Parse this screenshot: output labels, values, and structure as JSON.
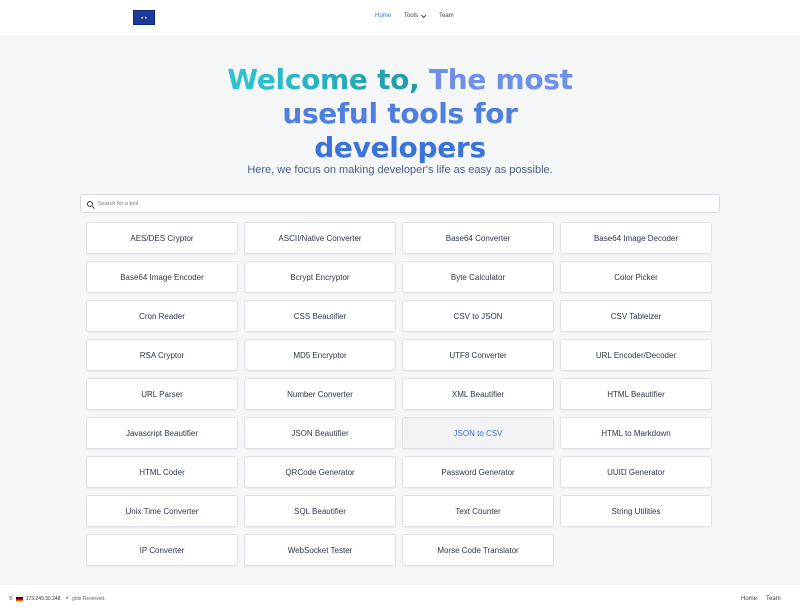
{
  "header": {
    "logo_text": "★★",
    "nav": [
      {
        "label": "Home",
        "active": true
      },
      {
        "label": "Tools"
      },
      {
        "label": "Team"
      }
    ]
  },
  "hero": {
    "title_part1": "Welcome to,",
    "title_part2": "The most",
    "title_part3": "useful tools for",
    "title_part4": "developers",
    "subtitle": "Here, we focus on making developer's life as easy as possible."
  },
  "search": {
    "placeholder": "Search for a tool",
    "value": ""
  },
  "tools": [
    "AES/DES Cryptor",
    "ASCII/Native Converter",
    "Base64 Converter",
    "Base64 Image Decoder",
    "Base64 Image Encoder",
    "Bcrypt Encryptor",
    "Byte Calculator",
    "Color Picker",
    "Cron Reader",
    "CSS Beautifier",
    "CSV to JSON",
    "CSV Tableizer",
    "RSA Cryptor",
    "MD5 Encryptor",
    "UTF8 Converter",
    "URL Encoder/Decoder",
    "URL Parser",
    "Number Converter",
    "XML Beautifier",
    "HTML Beautifier",
    "Javascript Beautifier",
    "JSON Beautifier",
    "JSON to CSV",
    "HTML to Markdown",
    "HTML Coder",
    "QRCode Generator",
    "Password Generator",
    "UUID Generator",
    "Unix Time Converter",
    "SQL Beautifier",
    "Text Counter",
    "String Utilities",
    "IP Converter",
    "WebSocket Tester",
    "Morse Code Translator"
  ],
  "highlighted_tool": "JSON to CSV",
  "footer": {
    "prefix": "©",
    "ip": "173.249.30.248",
    "close": "×",
    "rights": "ghts Reserved.",
    "nav_home": "Home",
    "nav_team": "Team"
  },
  "colors": {
    "accent": "#3b6fd6",
    "title_teal": "#2ec6d3",
    "title_blue": "#4f7fdf",
    "background": "#f5f6f8"
  }
}
